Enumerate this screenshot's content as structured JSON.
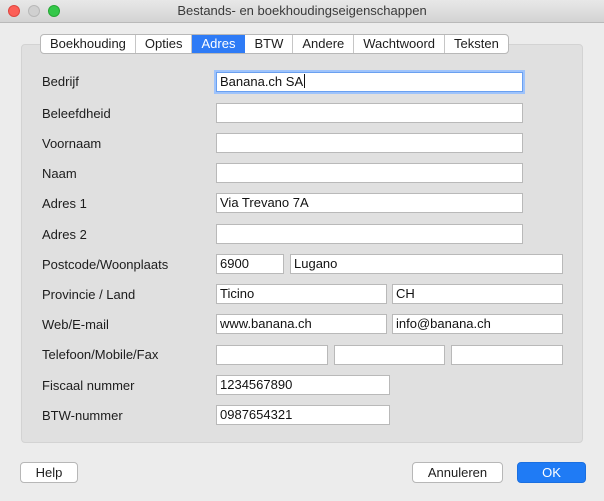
{
  "window": {
    "title": "Bestands- en boekhoudingseigenschappen"
  },
  "tabs": [
    {
      "label": "Boekhouding",
      "active": false
    },
    {
      "label": "Opties",
      "active": false
    },
    {
      "label": "Adres",
      "active": true
    },
    {
      "label": "BTW",
      "active": false
    },
    {
      "label": "Andere",
      "active": false
    },
    {
      "label": "Wachtwoord",
      "active": false
    },
    {
      "label": "Teksten",
      "active": false
    }
  ],
  "form": {
    "company": {
      "label": "Bedrijf",
      "value": "Banana.ch SA"
    },
    "courtesy": {
      "label": "Beleefdheid",
      "value": ""
    },
    "first_name": {
      "label": "Voornaam",
      "value": ""
    },
    "last_name": {
      "label": "Naam",
      "value": ""
    },
    "address1": {
      "label": "Adres 1",
      "value": "Via Trevano 7A"
    },
    "address2": {
      "label": "Adres 2",
      "value": ""
    },
    "zip_city": {
      "label": "Postcode/Woonplaats",
      "zip": "6900",
      "city": "Lugano"
    },
    "province_country": {
      "label": "Provincie / Land",
      "province": "Ticino",
      "country": "CH"
    },
    "web_email": {
      "label": "Web/E-mail",
      "web": "www.banana.ch",
      "email": "info@banana.ch"
    },
    "phones": {
      "label": "Telefoon/Mobile/Fax",
      "phone": "",
      "mobile": "",
      "fax": ""
    },
    "fiscal_number": {
      "label": "Fiscaal nummer",
      "value": "1234567890"
    },
    "vat_number": {
      "label": "BTW-nummer",
      "value": "0987654321"
    }
  },
  "buttons": {
    "help": "Help",
    "cancel": "Annuleren",
    "ok": "OK"
  },
  "colors": {
    "accent": "#2e7bf6",
    "close": "#fc5f57",
    "maximize": "#34c84a"
  }
}
